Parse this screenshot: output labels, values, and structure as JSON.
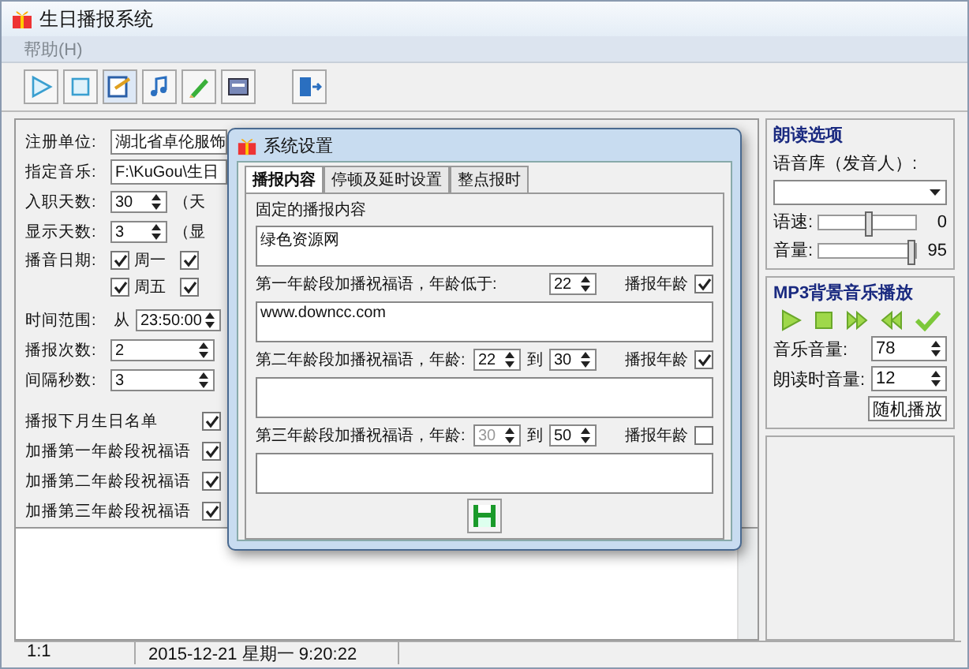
{
  "window": {
    "title": "生日播报系统"
  },
  "menu": [
    {
      "label": "帮助(H)",
      "disabled": true
    }
  ],
  "form": [
    {
      "kind": "text",
      "label": "注册单位:",
      "value": "湖北省卓伦服饰"
    },
    {
      "kind": "text",
      "label": "指定音乐:",
      "value": "F:\\KuGou\\生日"
    },
    {
      "kind": "spin",
      "label": "入职天数:",
      "value": "30",
      "note": "（天"
    },
    {
      "kind": "spin",
      "label": "显示天数:",
      "value": "3",
      "note": "（显"
    },
    {
      "kind": "days",
      "label": "播音日期:",
      "days": [
        {
          "label": "周一",
          "checked": true
        },
        {
          "checked": true
        },
        {
          "label": "周五",
          "checked": true
        },
        {
          "checked": true
        }
      ]
    },
    {
      "kind": "time",
      "label": "时间范围:",
      "prefix": "从",
      "value": "23:50:00"
    },
    {
      "kind": "spin",
      "label": "播报次数:",
      "value": "2"
    },
    {
      "kind": "spin",
      "label": "间隔秒数:",
      "value": "3"
    }
  ],
  "options": [
    {
      "label": "播报下月生日名单",
      "checked": true
    },
    {
      "label": "加播第一年龄段祝福语",
      "checked": true
    },
    {
      "label": "加播第二年龄段祝福语",
      "checked": true
    },
    {
      "label": "加播第三年龄段祝福语",
      "checked": true
    }
  ],
  "dialog": {
    "title": "系统设置",
    "tabs": [
      {
        "label": "播报内容",
        "selected": true
      },
      {
        "label": "停顿及延时设置",
        "selected": false
      },
      {
        "label": "整点报时",
        "selected": false
      }
    ],
    "fixed_label": "固定的播报内容",
    "fixed_text": "绿色资源网",
    "groups": [
      {
        "label": "第一年龄段加播祝福语，年龄低于:",
        "spins": [
          {
            "value": "22",
            "disabled": false
          }
        ],
        "check_label": "播报年龄",
        "checked": true,
        "text": "www.downcc.com"
      },
      {
        "label": "第二年龄段加播祝福语，年龄:",
        "spins": [
          {
            "value": "22",
            "disabled": false
          },
          {
            "value": "30",
            "disabled": false
          }
        ],
        "to": "到",
        "check_label": "播报年龄",
        "checked": true
      },
      {
        "label": "第三年龄段加播祝福语，年龄:",
        "spins": [
          {
            "value": "30",
            "disabled": true
          },
          {
            "value": "50",
            "disabled": false
          }
        ],
        "to": "到",
        "check_label": "播报年龄",
        "checked": false
      }
    ]
  },
  "reading": {
    "title": "朗读选项",
    "voice_label": "语音库（发音人）:",
    "sliders": [
      {
        "label": "语速:",
        "level": 0.5,
        "reading": "0"
      },
      {
        "label": "音量:",
        "level": 0.95,
        "reading": "95"
      }
    ]
  },
  "mp3": {
    "title": "MP3背景音乐播放",
    "fields": [
      {
        "label": "音乐音量:",
        "value": "78"
      },
      {
        "label": "朗读时音量:",
        "value": "12"
      }
    ],
    "mode": "随机播放"
  },
  "status_bar": [
    "1:1",
    "2015-12-21 星期一 9:20:22"
  ]
}
